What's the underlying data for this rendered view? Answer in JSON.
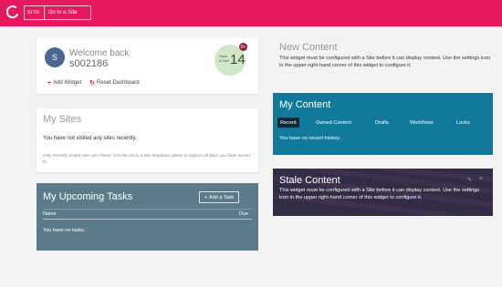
{
  "header": {
    "site_label": "SITE:",
    "site_button": "Go to a Site",
    "brand_color": "#e8185f"
  },
  "welcome": {
    "avatar_letter": "S",
    "title": "Welcome back",
    "username": "s002186",
    "stat_label": "Tasks & Stuff",
    "stat_value": "14",
    "stat_badge": "0+",
    "add_widget": "Add Widget",
    "reset_dashboard": "Reset Dashboard"
  },
  "my_sites": {
    "title": "My Sites",
    "empty": "You have not visited any sites recently.",
    "note": "Only recently visited sites are shown. Use the Go to a Site dropdown above to explore all Sites you have access to."
  },
  "tasks": {
    "title": "My Upcoming Tasks",
    "add_task": "Add a Task",
    "col_name": "Name",
    "col_due": "Due",
    "empty": "You have no tasks.",
    "bg_color": "#5c7b8a"
  },
  "new_content": {
    "title": "New Content",
    "text": "This widget must be configured with a Site before it can display content. Use the settings icon in the upper right-hand corner of this widget to configure it."
  },
  "my_content": {
    "title": "My Content",
    "tabs": [
      "Recent",
      "Owned Content",
      "Drafts",
      "Workflows",
      "Locks"
    ],
    "active_tab": "Recent",
    "empty": "You have no recent history.",
    "bg_color": "#117a9c"
  },
  "stale_content": {
    "title": "Stale Content",
    "text": "This widget must be configured with a Site before it can display content. Use the settings icon in the upper right-hand corner of this widget to configure it.",
    "bg_color": "#332c45"
  }
}
